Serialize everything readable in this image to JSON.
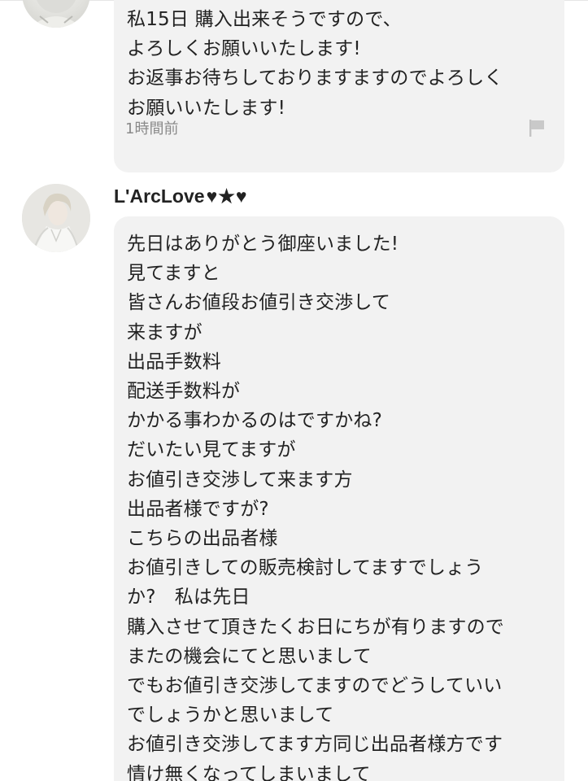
{
  "previous_comment": {
    "lines": [
      "私15日 購入出来そうですので、",
      "よろしくお願いいたします!",
      "お返事お待ちしておりますますのでよろしく",
      "お願いいたします!"
    ],
    "time": "1時間前",
    "flag_icon": "flag-icon"
  },
  "comment": {
    "username": "L'ArcLove",
    "username_suffix": "♥★♥",
    "avatar_icon": "user-avatar",
    "lines": [
      "先日はありがとう御座いました!",
      "見てますと",
      "皆さんお値段お値引き交渉して",
      "来ますが",
      "出品手数料",
      "配送手数料が",
      "かかる事わかるのはですかね?",
      "だいたい見てますが",
      "お値引き交渉して来ます方",
      "出品者様ですが?",
      "こちらの出品者様",
      "お値引きしての販売検討してますでしょう",
      "か?　私は先日",
      "購入させて頂きたくお日にちが有りますので",
      "またの機会にてと思いまして",
      "でもお値引き交渉してますのでどうしていい",
      "でしょうかと思いまして",
      "お値引き交渉してます方同じ出品者様方です",
      "情け無くなってしまいまして"
    ]
  }
}
